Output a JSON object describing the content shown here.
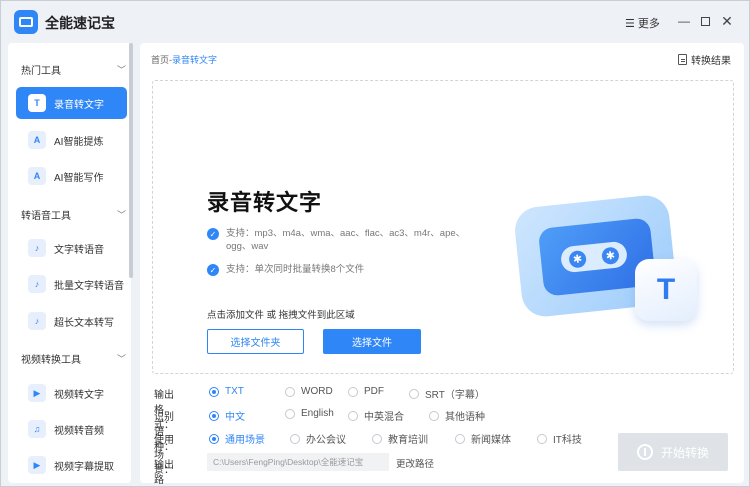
{
  "app": {
    "title": "全能速记宝"
  },
  "titlebar": {
    "more_label": "更多",
    "more_icon": "menu-icon"
  },
  "sidebar": {
    "groups": [
      {
        "label": "热门工具"
      },
      {
        "label": "转语音工具"
      },
      {
        "label": "视频转换工具"
      }
    ],
    "items": [
      {
        "label": "录音转文字",
        "icon": "T"
      },
      {
        "label": "AI智能提炼",
        "icon": "A"
      },
      {
        "label": "AI智能写作",
        "icon": "A"
      },
      {
        "label": "文字转语音",
        "icon": "♪"
      },
      {
        "label": "批量文字转语音",
        "icon": "♪"
      },
      {
        "label": "超长文本转写",
        "icon": "♪"
      },
      {
        "label": "视频转文字",
        "icon": "▶"
      },
      {
        "label": "视频转音频",
        "icon": "♫"
      },
      {
        "label": "视频字幕提取",
        "icon": "▶"
      }
    ]
  },
  "breadcrumb": {
    "home": "首页",
    "sep": "-",
    "current": "录音转文字"
  },
  "result_label": "转换结果",
  "dropzone": {
    "title": "录音转文字",
    "feature1": "支持：mp3、m4a、wma、aac、flac、ac3、m4r、ape、ogg、wav",
    "feature2": "支持：单次同时批量转换8个文件",
    "hint": "点击添加文件 或 拖拽文件到此区域",
    "select_folder": "选择文件夹",
    "select_file": "选择文件"
  },
  "options": {
    "format": {
      "label": "输出格式：",
      "choices": [
        "TXT",
        "WORD",
        "PDF",
        "SRT（字幕）"
      ],
      "selected": "TXT"
    },
    "language": {
      "label": "识别语种：",
      "choices": [
        "中文",
        "English",
        "中英混合",
        "其他语种"
      ],
      "selected": "中文"
    },
    "scene": {
      "label": "使用场景：",
      "choices": [
        "通用场景",
        "办公会议",
        "教育培训",
        "新闻媒体",
        "IT科技"
      ],
      "selected": "通用场景"
    },
    "path": {
      "label": "输出路径：",
      "value": "C:\\Users\\FengPing\\Desktop\\全能速记宝",
      "change": "更改路径"
    }
  },
  "start_label": "开始转换",
  "colors": {
    "accent": "#2f86f6",
    "disabled": "#dfe2e6"
  }
}
